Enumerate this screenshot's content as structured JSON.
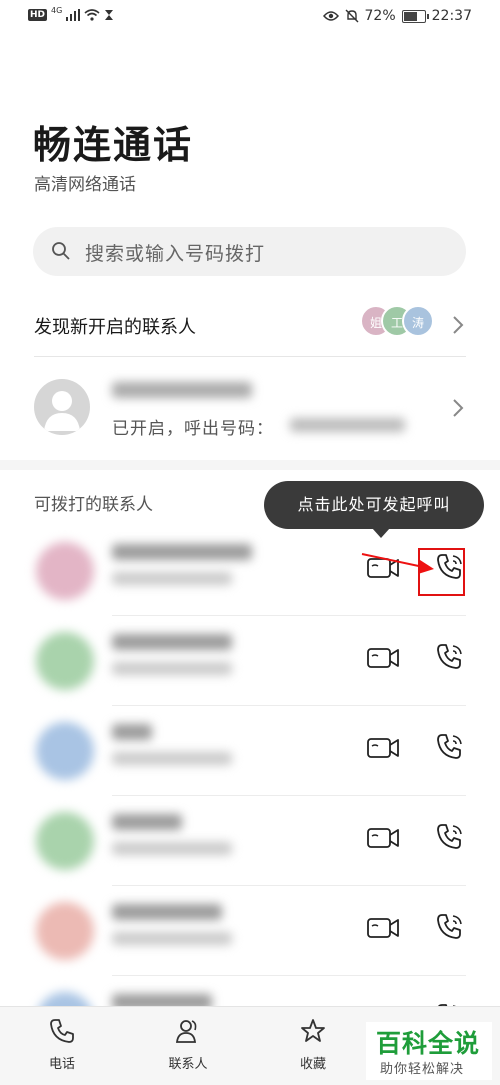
{
  "status_bar": {
    "hd": "HD",
    "network": "4G",
    "battery_percent": "72%",
    "battery_level": 0.72,
    "time": "22:37"
  },
  "header": {
    "title": "畅连通话",
    "subtitle": "高清网络通话"
  },
  "search": {
    "placeholder": "搜索或输入号码拨打"
  },
  "discover": {
    "label": "发现新开启的联系人",
    "avatars": [
      {
        "initial": "姐",
        "color": "#d9b4c4"
      },
      {
        "initial": "工",
        "color": "#9fc9a6"
      },
      {
        "initial": "涛",
        "color": "#a9c3de"
      }
    ]
  },
  "enabled_contact": {
    "status_text": "已开启，呼出号码："
  },
  "callable_section": {
    "title": "可拨打的联系人",
    "tooltip": "点击此处可发起呼叫",
    "contacts": [
      {
        "avatar_color": "#e3b5c6"
      },
      {
        "avatar_color": "#a9d3ac"
      },
      {
        "avatar_color": "#a9c4e4"
      },
      {
        "avatar_color": "#a9d3ac"
      },
      {
        "avatar_color": "#ecbab4"
      },
      {
        "avatar_color": "#a9c4e4"
      }
    ]
  },
  "bottom_nav": {
    "items": [
      {
        "label": "电话",
        "icon": "phone-icon"
      },
      {
        "label": "联系人",
        "icon": "person-icon"
      },
      {
        "label": "收藏",
        "icon": "star-icon"
      }
    ]
  },
  "watermark": {
    "main": "百科全说",
    "sub": "助你轻松解决"
  },
  "colors": {
    "highlight": "#e11111",
    "watermark_green": "#1f9d3a"
  }
}
